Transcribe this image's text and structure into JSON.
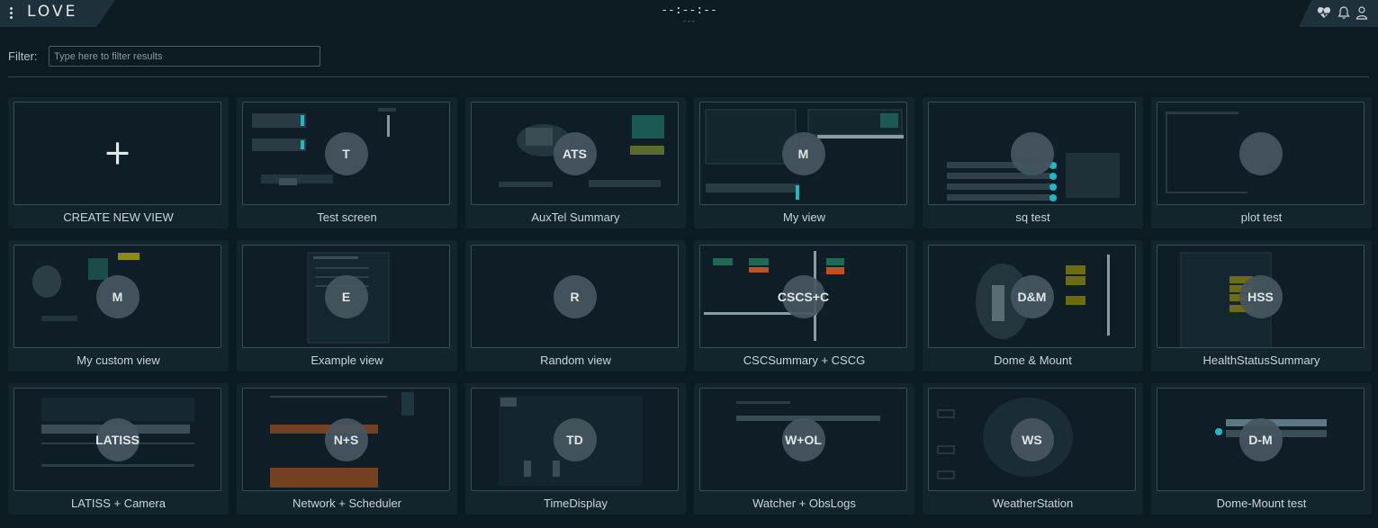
{
  "header": {
    "logo": "LOVE",
    "clock": "--:--:--",
    "clock_sub": "---"
  },
  "filter": {
    "label": "Filter:",
    "placeholder": "Type here to filter results"
  },
  "views": [
    {
      "name": "CREATE NEW VIEW",
      "badge": "+",
      "kind": "create"
    },
    {
      "name": "Test screen",
      "badge": "T"
    },
    {
      "name": "AuxTel Summary",
      "badge": "ATS"
    },
    {
      "name": "My view",
      "badge": "M"
    },
    {
      "name": "sq test",
      "badge": ""
    },
    {
      "name": "plot test",
      "badge": ""
    },
    {
      "name": "My custom view",
      "badge": "M"
    },
    {
      "name": "Example view",
      "badge": "E"
    },
    {
      "name": "Random view",
      "badge": "R"
    },
    {
      "name": "CSCSummary + CSCG",
      "badge": "CSCS+C"
    },
    {
      "name": "Dome & Mount",
      "badge": "D&M"
    },
    {
      "name": "HealthStatusSummary",
      "badge": "HSS"
    },
    {
      "name": "LATISS + Camera",
      "badge": "LATISS"
    },
    {
      "name": "Network + Scheduler",
      "badge": "N+S"
    },
    {
      "name": "TimeDisplay",
      "badge": "TD"
    },
    {
      "name": "Watcher + ObsLogs",
      "badge": "W+OL"
    },
    {
      "name": "WeatherStation",
      "badge": "WS"
    },
    {
      "name": "Dome-Mount test",
      "badge": "D-M"
    }
  ],
  "icons": {
    "menu": "vertical-dots-icon",
    "heartbeat": "heart-icon",
    "alarm": "bell-icon",
    "user": "user-icon"
  },
  "colors": {
    "background": "#0c1a22",
    "card": "#14242d",
    "accent": "#1fb8c4"
  }
}
